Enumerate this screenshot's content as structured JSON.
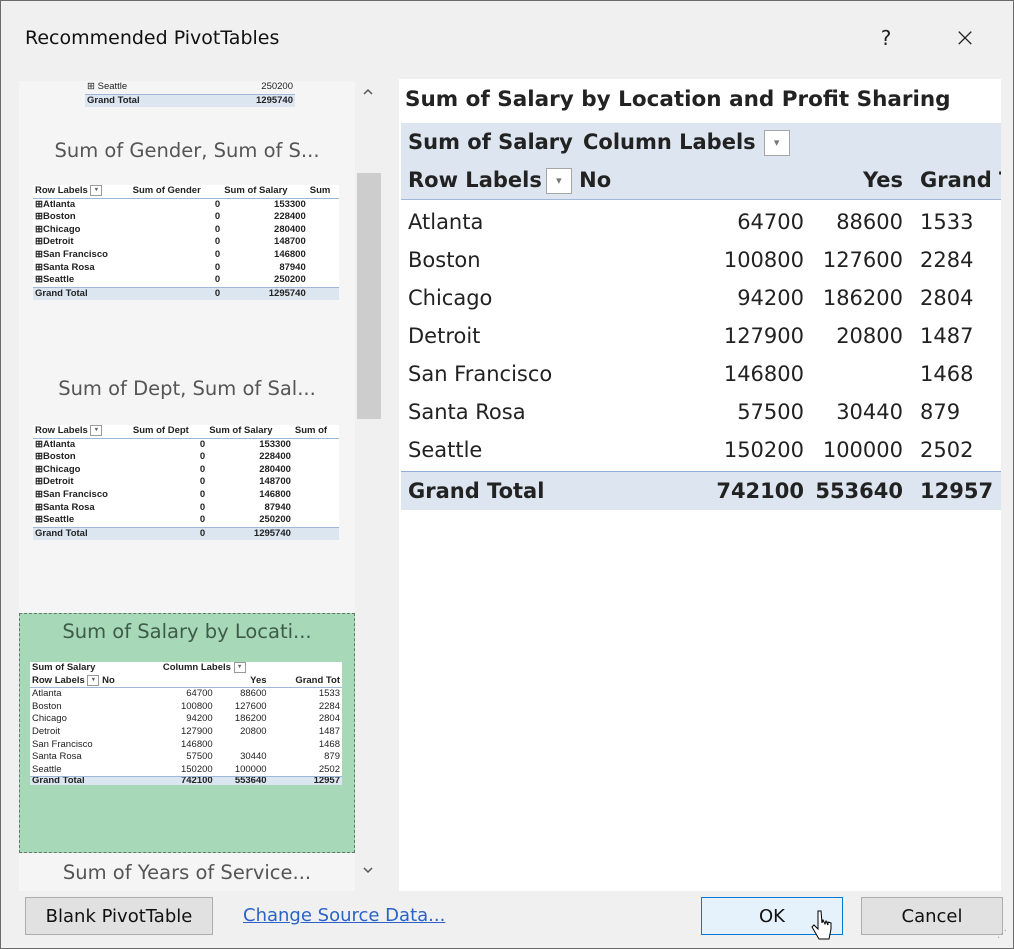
{
  "dialog": {
    "title": "Recommended PivotTables",
    "help": "?",
    "close": "×"
  },
  "thumbnails": [
    {
      "title": "",
      "partial_rows": [
        {
          "label": "Seattle",
          "salary": "250200"
        },
        {
          "label": "Grand Total",
          "salary": "1295740"
        }
      ]
    },
    {
      "title": "Sum of Gender, Sum of S...",
      "headers": [
        "Row Labels",
        "Sum of Gender",
        "Sum of Salary",
        "Sum"
      ],
      "rows": [
        [
          "Atlanta",
          "0",
          "153300"
        ],
        [
          "Boston",
          "0",
          "228400"
        ],
        [
          "Chicago",
          "0",
          "280400"
        ],
        [
          "Detroit",
          "0",
          "148700"
        ],
        [
          "San Francisco",
          "0",
          "146800"
        ],
        [
          "Santa Rosa",
          "0",
          "87940"
        ],
        [
          "Seattle",
          "0",
          "250200"
        ]
      ],
      "total": [
        "Grand Total",
        "0",
        "1295740"
      ]
    },
    {
      "title": "Sum of Dept, Sum of Sal...",
      "headers": [
        "Row Labels",
        "Sum of Dept",
        "Sum of Salary",
        "Sum of"
      ],
      "rows": [
        [
          "Atlanta",
          "0",
          "153300"
        ],
        [
          "Boston",
          "0",
          "228400"
        ],
        [
          "Chicago",
          "0",
          "280400"
        ],
        [
          "Detroit",
          "0",
          "148700"
        ],
        [
          "San Francisco",
          "0",
          "146800"
        ],
        [
          "Santa Rosa",
          "0",
          "87940"
        ],
        [
          "Seattle",
          "0",
          "250200"
        ]
      ],
      "total": [
        "Grand Total",
        "0",
        "1295740"
      ]
    },
    {
      "title": "Sum of Salary by Locati...",
      "selected": true,
      "header1": [
        "Sum of Salary",
        "Column Labels"
      ],
      "header2": [
        "Row Labels",
        "No",
        "Yes",
        "Grand Tot"
      ],
      "rows": [
        [
          "Atlanta",
          "64700",
          "88600",
          "1533"
        ],
        [
          "Boston",
          "100800",
          "127600",
          "2284"
        ],
        [
          "Chicago",
          "94200",
          "186200",
          "2804"
        ],
        [
          "Detroit",
          "127900",
          "20800",
          "1487"
        ],
        [
          "San Francisco",
          "146800",
          "",
          "1468"
        ],
        [
          "Santa Rosa",
          "57500",
          "30440",
          "879"
        ],
        [
          "Seattle",
          "150200",
          "100000",
          "2502"
        ]
      ],
      "total": [
        "Grand Total",
        "742100",
        "553640",
        "12957"
      ]
    },
    {
      "title": "Sum of Years of Service..."
    }
  ],
  "scroll": {
    "up": "^",
    "down": "v"
  },
  "preview": {
    "title": "Sum of Salary by Location and Profit Sharing",
    "header1": [
      "Sum of Salary",
      "Column Labels"
    ],
    "header2": [
      "Row Labels",
      "No",
      "Yes",
      "Grand To"
    ],
    "rows": [
      [
        "Atlanta",
        "64700",
        "88600",
        "1533"
      ],
      [
        "Boston",
        "100800",
        "127600",
        "2284"
      ],
      [
        "Chicago",
        "94200",
        "186200",
        "2804"
      ],
      [
        "Detroit",
        "127900",
        "20800",
        "1487"
      ],
      [
        "San Francisco",
        "146800",
        "",
        "1468"
      ],
      [
        "Santa Rosa",
        "57500",
        "30440",
        "879"
      ],
      [
        "Seattle",
        "150200",
        "100000",
        "2502"
      ]
    ],
    "total": [
      "Grand Total",
      "742100",
      "553640",
      "12957"
    ]
  },
  "buttons": {
    "blank": "Blank PivotTable",
    "change_source": "Change Source Data...",
    "ok": "OK",
    "cancel": "Cancel"
  }
}
